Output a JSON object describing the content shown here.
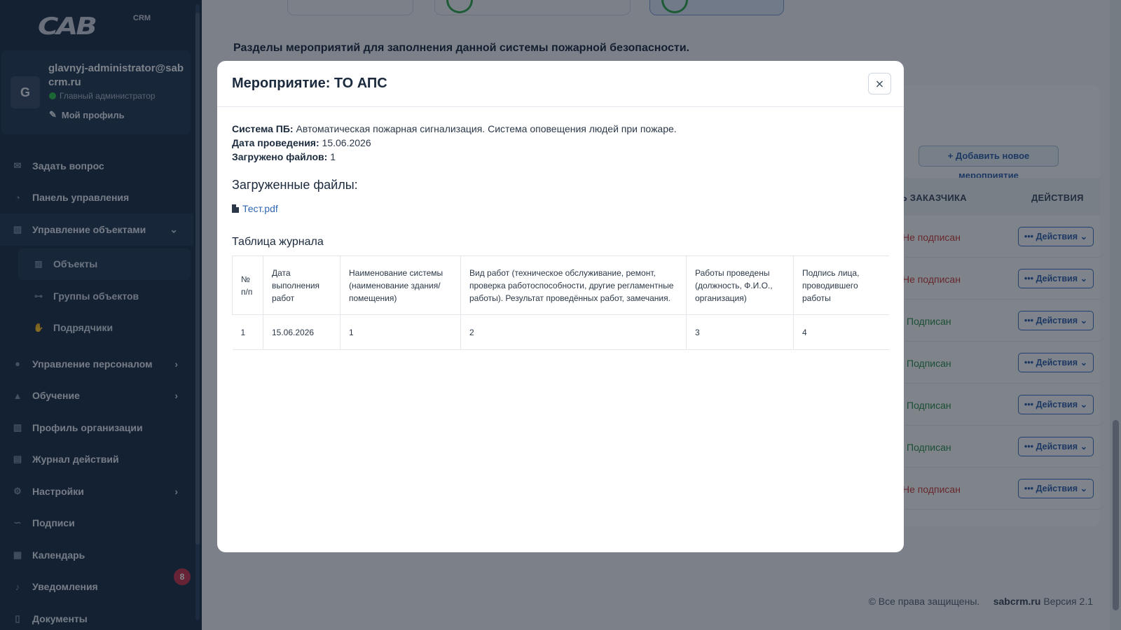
{
  "brand": {
    "logo": "CAB",
    "logo_suffix": "CRM"
  },
  "profile": {
    "avatar_letter": "G",
    "name": "glavnyj-administrator@sabcrm.ru",
    "role": "Главный администратор",
    "profile_link": "Мой профиль"
  },
  "sidebar": {
    "items": [
      {
        "label": "Задать вопрос",
        "icon": "envelope-icon"
      },
      {
        "label": "Панель управления",
        "icon": "gauge-icon"
      },
      {
        "label": "Управление объектами",
        "icon": "building-icon",
        "expanded": true
      },
      {
        "label": "Объекты",
        "icon": "building-icon",
        "sub": true,
        "active": true
      },
      {
        "label": "Группы объектов",
        "icon": "sitemap-icon",
        "sub": true
      },
      {
        "label": "Подрядчики",
        "icon": "handshake-icon",
        "sub": true
      },
      {
        "label": "Управление персоналом",
        "icon": "user-icon"
      },
      {
        "label": "Обучение",
        "icon": "graduation-cap-icon"
      },
      {
        "label": "Профиль организации",
        "icon": "building-icon"
      },
      {
        "label": "Журнал действий",
        "icon": "clipboard-icon"
      },
      {
        "label": "Настройки",
        "icon": "gears-icon"
      },
      {
        "label": "Подписи",
        "icon": "signature-icon"
      },
      {
        "label": "Календарь",
        "icon": "calendar-icon"
      },
      {
        "label": "Уведомления",
        "icon": "bell-icon",
        "badge": "8"
      },
      {
        "label": "Документы",
        "icon": "file-icon"
      }
    ]
  },
  "main": {
    "section_title": "Разделы мероприятий для заполнения данной системы пожарной безопасности.",
    "add_button": "Добавить новое мероприятие",
    "columns": {
      "client_signature": "ИСЬ ЗАКАЗЧИКА",
      "actions": "ДЕЙСТВИЯ"
    },
    "rows": [
      {
        "signature": "Не подписан",
        "status": "no",
        "action": "Действия"
      },
      {
        "signature": "Не подписан",
        "status": "no",
        "action": "Действия"
      },
      {
        "signature": "Подписан",
        "status": "yes",
        "action": "Действия"
      },
      {
        "signature": "Подписан",
        "status": "yes",
        "action": "Действия"
      },
      {
        "signature": "Подписан",
        "status": "yes",
        "action": "Действия"
      },
      {
        "signature": "Подписан",
        "status": "yes",
        "action": "Действия"
      },
      {
        "signature": "Не подписан",
        "status": "no",
        "action": "Действия"
      }
    ],
    "footer": {
      "copyright": "© Все права защищены.",
      "site": "sabcrm.ru",
      "version": "Версия 2.1"
    }
  },
  "modal": {
    "title": "Мероприятие: ТО АПС",
    "close": "×",
    "system_label": "Система ПБ:",
    "system_value": "Автоматическая пожарная сигнализация. Система оповещения людей при пожаре.",
    "date_label": "Дата проведения:",
    "date_value": "15.06.2026",
    "files_count_label": "Загружено файлов:",
    "files_count_value": "1",
    "files_title": "Загруженные файлы:",
    "file_name": "Тест.pdf",
    "journal_title": "Таблица журнала",
    "journal_headers": [
      "№ п/п",
      "Дата выполнения работ",
      "Наименование системы (наименование здания/помещения)",
      "Вид работ (техническое обслуживание, ремонт, проверка работоспособности, другие регламентные работы). Результат проведённых работ, замечания.",
      "Работы проведены (должность, Ф.И.О., организация)",
      "Подпись лица, проводившего работы"
    ],
    "journal_rows": [
      [
        "1",
        "15.06.2026",
        "1",
        "2",
        "3",
        "4"
      ]
    ]
  }
}
